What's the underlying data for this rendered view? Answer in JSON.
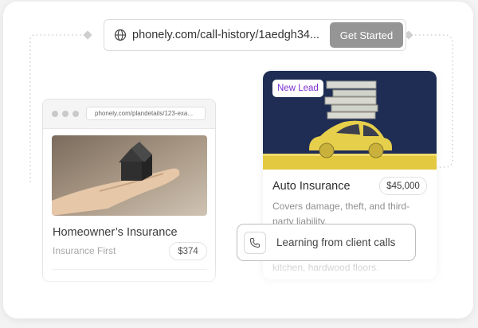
{
  "url_bar": {
    "url": "phonely.com/call-history/1aedgh34...",
    "cta_label": "Get Started"
  },
  "browser_card": {
    "mini_url": "phonely.com/plandetails/123-exa...",
    "title": "Homeowner’s Insurance",
    "subtitle": "Insurance First",
    "price": "$374"
  },
  "auto_card": {
    "badge": "New Lead",
    "title": "Auto Insurance",
    "price": "$45,000",
    "description": "Covers damage, theft, and third-party liability.",
    "faded_text": "kitchen, hardwood floors."
  },
  "learning_pill": {
    "label": "Learning from client calls"
  },
  "colors": {
    "accent_purple": "#7b2fd0",
    "navy": "#1f2d54",
    "car_yellow": "#e6cf4a",
    "button_gray": "#959595"
  },
  "icons": [
    "globe-icon",
    "phone-icon"
  ]
}
